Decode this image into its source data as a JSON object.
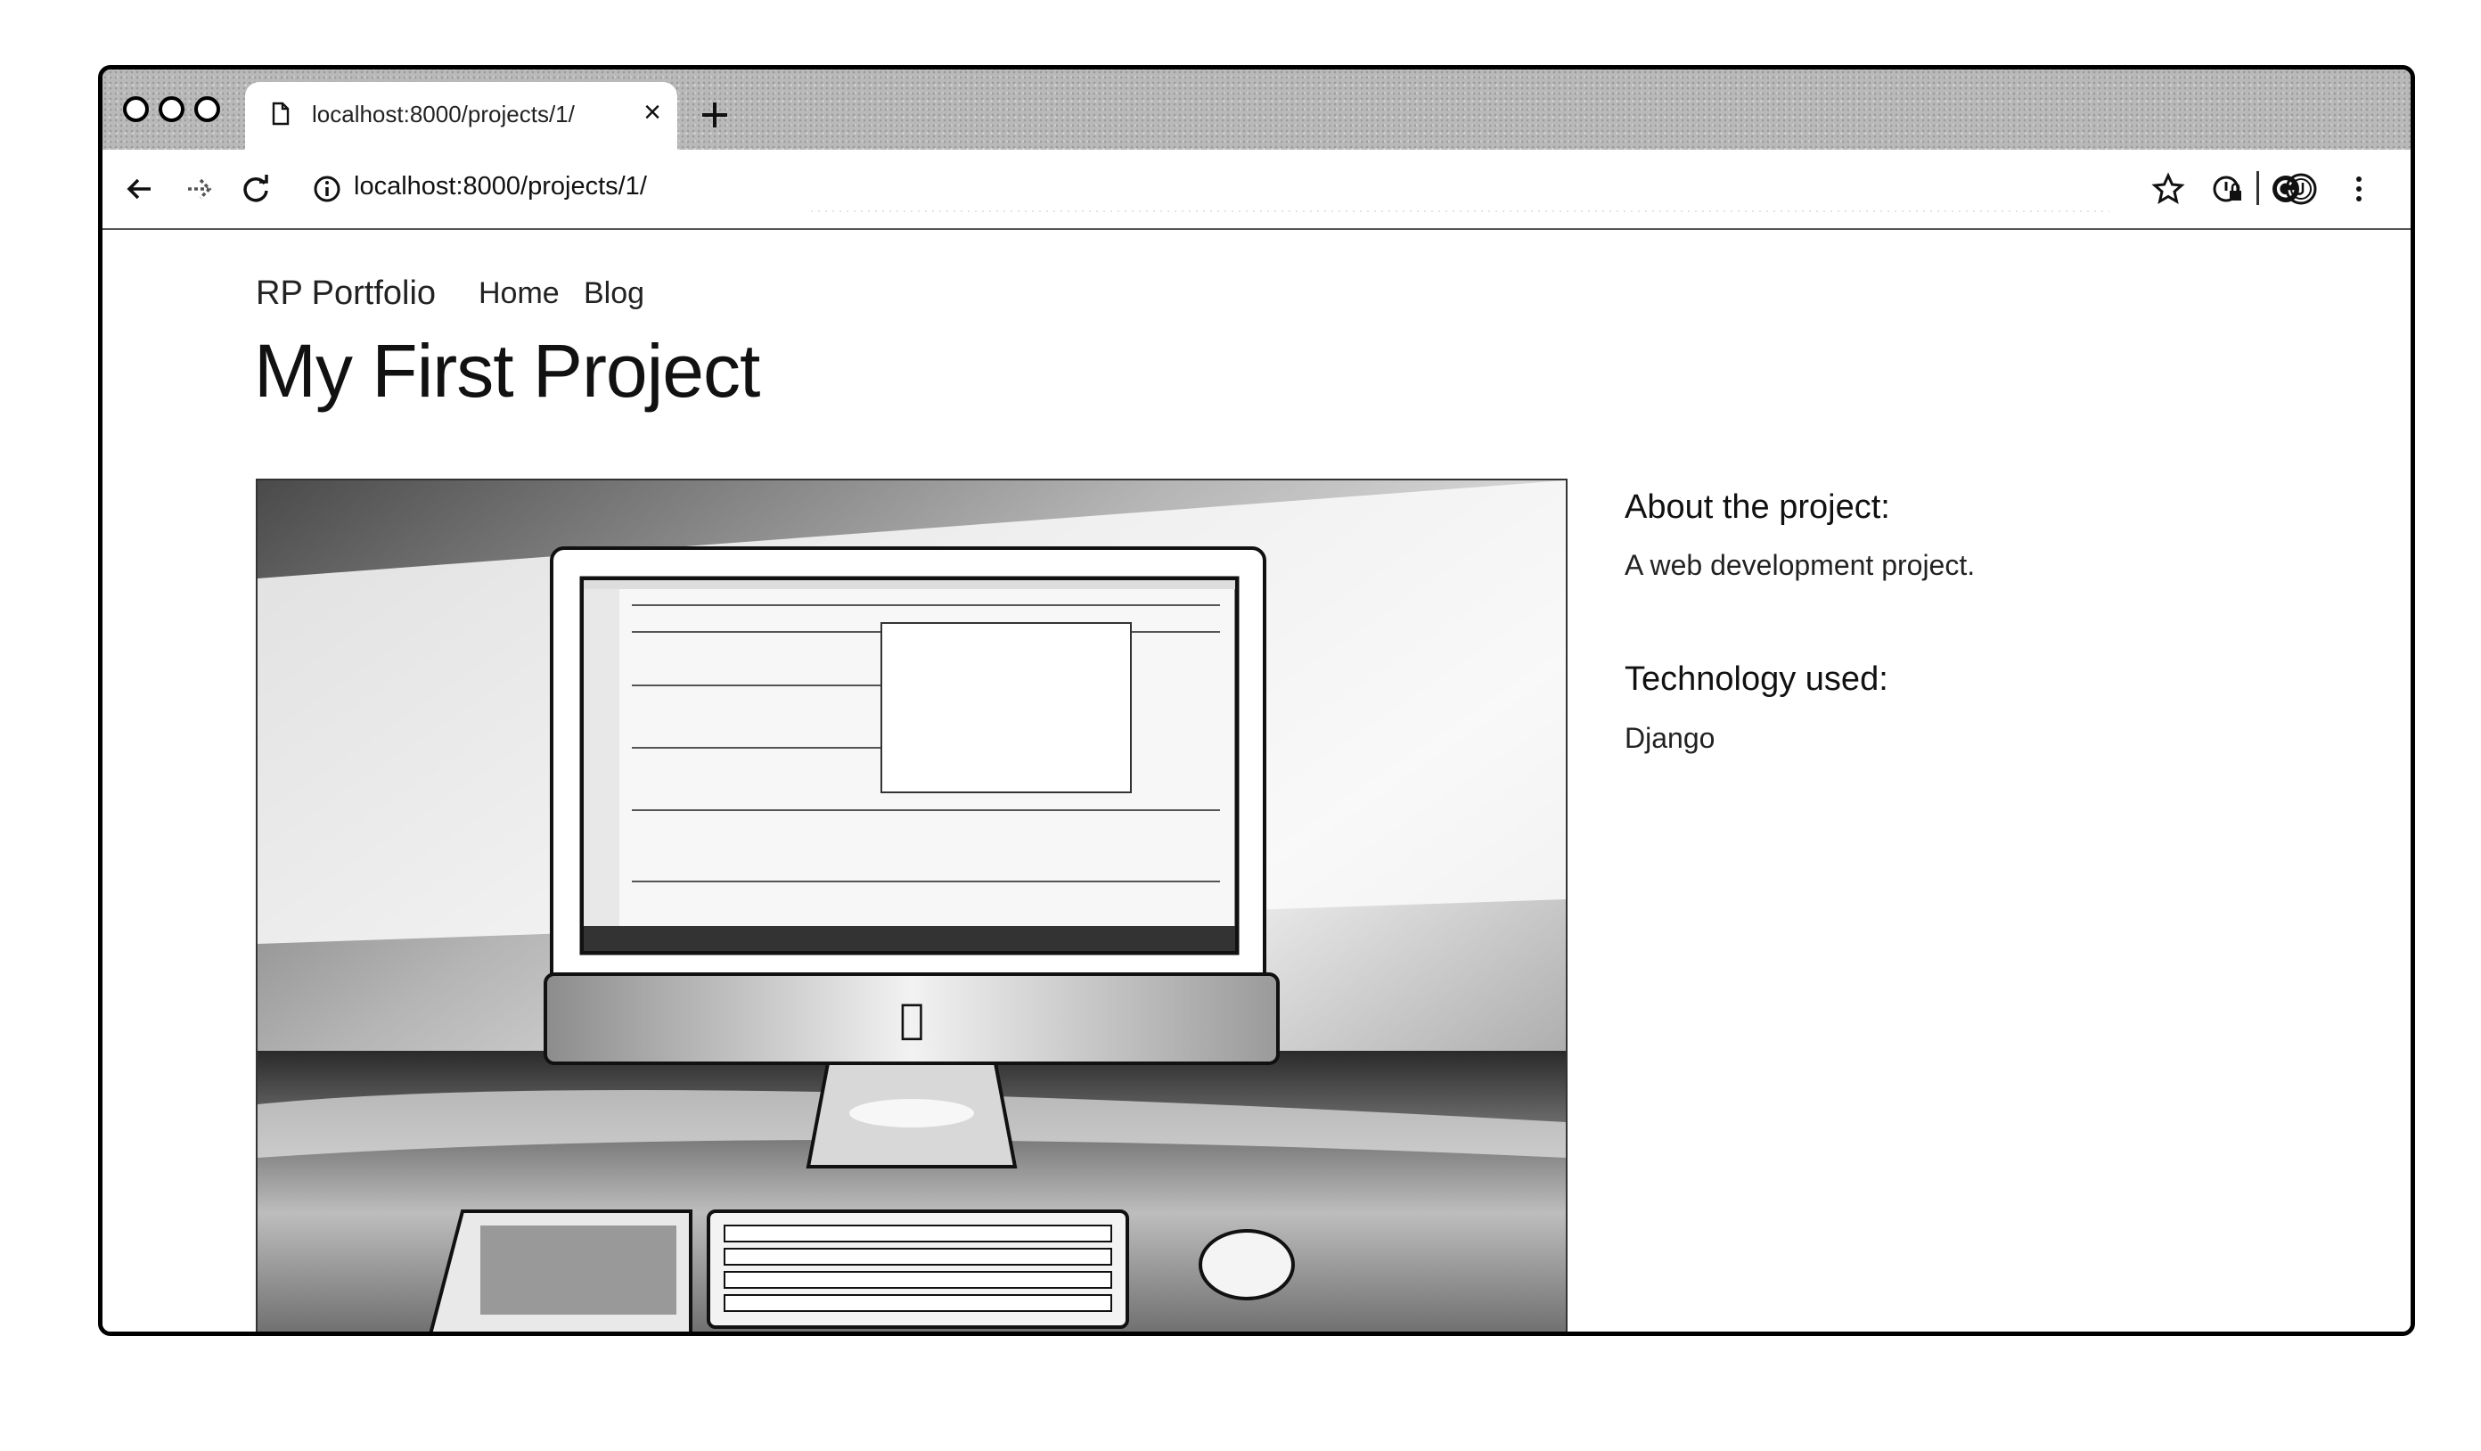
{
  "browser": {
    "tab": {
      "title": "localhost:8000/projects/1/"
    },
    "url": "localhost:8000/projects/1/"
  },
  "site": {
    "brand": "RP Portfolio",
    "nav": [
      {
        "label": "Home"
      },
      {
        "label": "Blog"
      }
    ]
  },
  "project": {
    "title": "My First Project",
    "about_heading": "About the project:",
    "description": "A web development project.",
    "technology_heading": "Technology used:",
    "technology": "Django"
  },
  "icons": {
    "tab": "page-icon",
    "close": "close-icon",
    "new_tab": "plus-icon",
    "back": "back-arrow-icon",
    "forward": "forward-arrow-icon",
    "reload": "reload-icon",
    "site_info": "info-icon",
    "bookmark": "star-icon",
    "extension_1": "extension-lock-icon",
    "extension_2": "grammarly-icon",
    "profile": "profile-avatar-icon",
    "menu": "kebab-menu-icon"
  }
}
